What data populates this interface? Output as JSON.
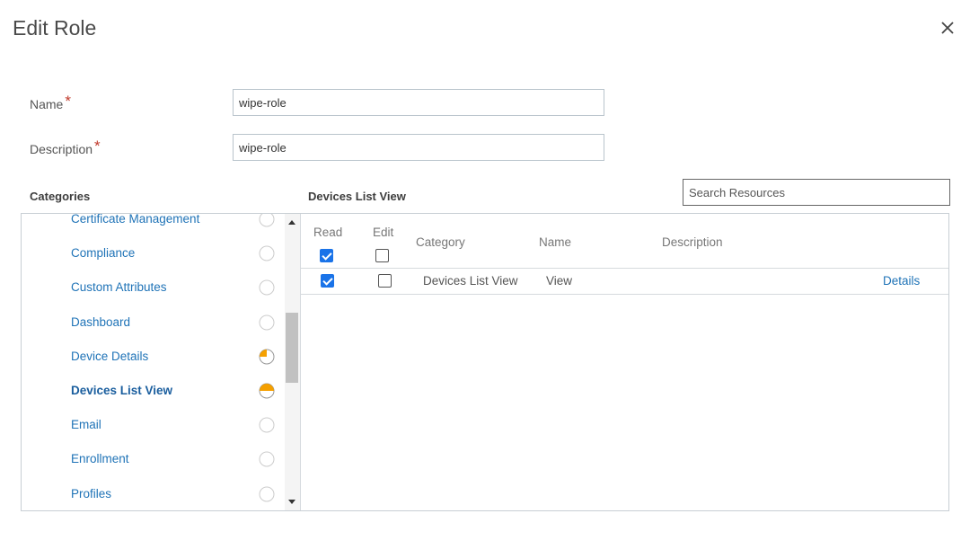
{
  "dialog": {
    "title": "Edit Role"
  },
  "form": {
    "name_label": "Name",
    "name_value": "wipe-role",
    "description_label": "Description",
    "description_value": "wipe-role",
    "required_mark": "*"
  },
  "categories": {
    "heading": "Categories",
    "items": [
      {
        "label": "Certificate Management",
        "state": "none"
      },
      {
        "label": "Compliance",
        "state": "none"
      },
      {
        "label": "Custom Attributes",
        "state": "none"
      },
      {
        "label": "Dashboard",
        "state": "none"
      },
      {
        "label": "Device Details",
        "state": "quarter"
      },
      {
        "label": "Devices List View",
        "state": "half",
        "selected": true
      },
      {
        "label": "Email",
        "state": "none"
      },
      {
        "label": "Enrollment",
        "state": "none"
      },
      {
        "label": "Profiles",
        "state": "none"
      }
    ]
  },
  "resources": {
    "heading": "Devices List View",
    "search_placeholder": "Search Resources",
    "columns": {
      "read": "Read",
      "edit": "Edit",
      "category": "Category",
      "name": "Name",
      "description": "Description"
    },
    "header_read_checked": true,
    "header_edit_checked": false,
    "rows": [
      {
        "read": true,
        "edit": false,
        "category": "Devices List View",
        "name": "View",
        "description": "",
        "details_label": "Details"
      }
    ]
  },
  "colors": {
    "link": "#1f73b7",
    "accent_orange": "#f5a000",
    "checkbox_blue": "#1a73e8",
    "required_red": "#c0392b"
  },
  "icons": {
    "close": "close-icon",
    "status_empty": "circle-empty-icon",
    "status_quarter": "circle-quarter-icon",
    "status_half": "circle-half-icon"
  }
}
